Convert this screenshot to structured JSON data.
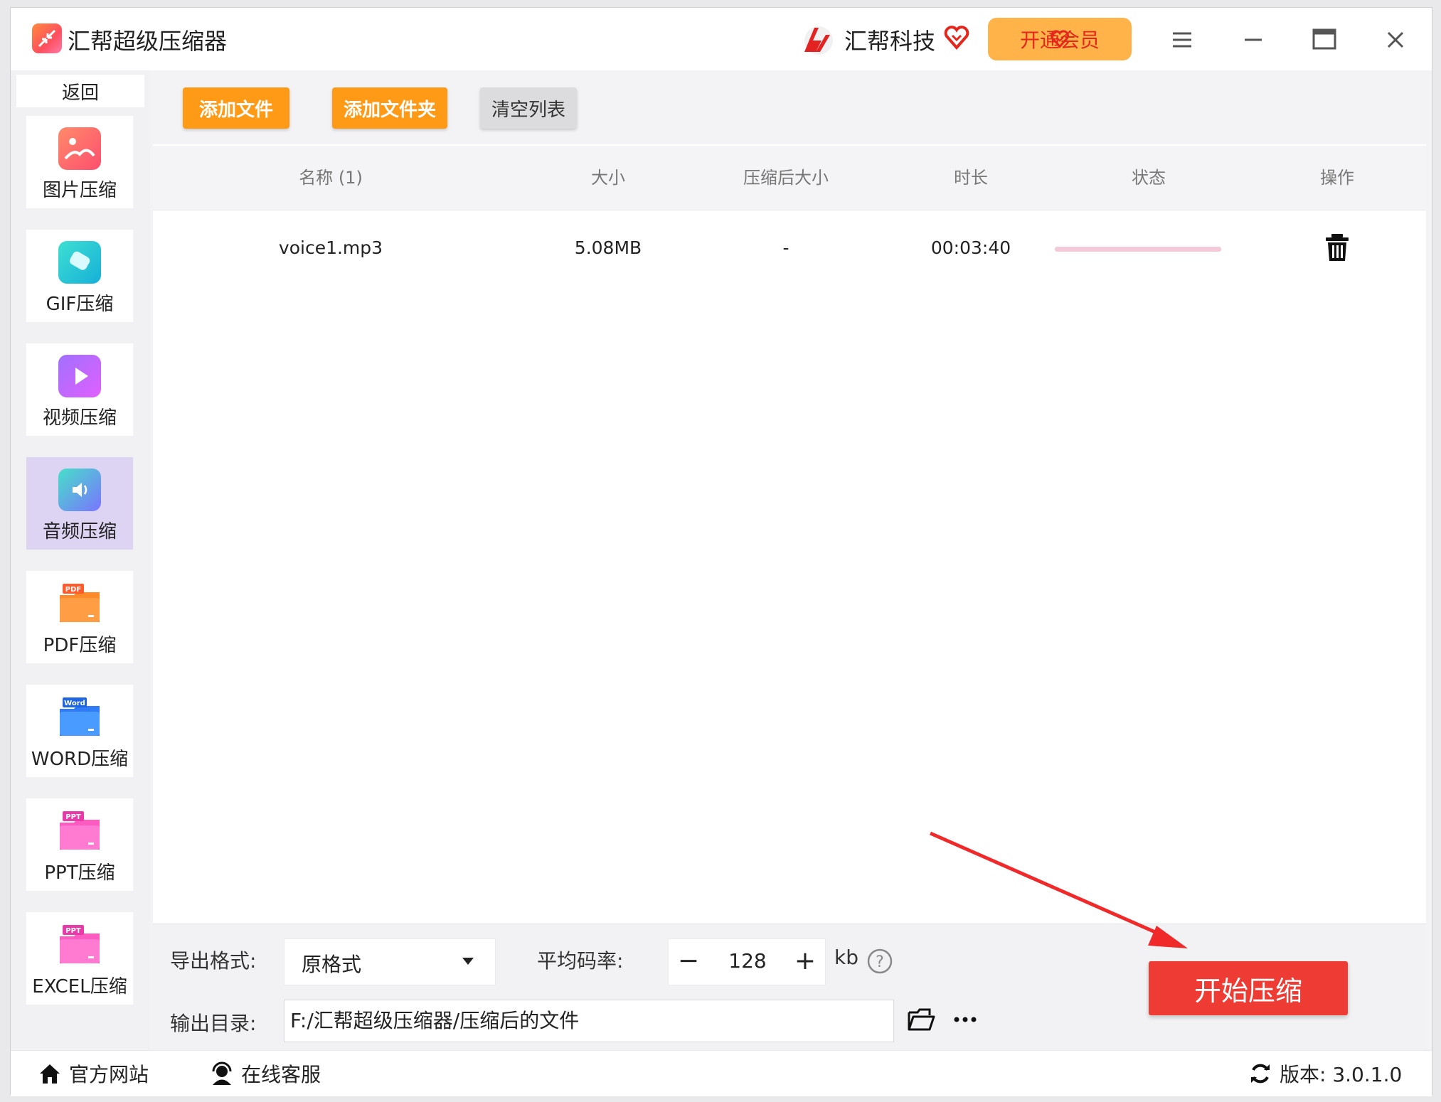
{
  "app": {
    "title": "汇帮超级压缩器"
  },
  "header": {
    "brand": "汇帮科技",
    "vip_label": "开通会员"
  },
  "sidebar": {
    "back_label": "返回",
    "items": [
      {
        "label": "图片压缩",
        "icon": "image-icon"
      },
      {
        "label": "GIF压缩",
        "icon": "gif-icon"
      },
      {
        "label": "视频压缩",
        "icon": "video-play-icon"
      },
      {
        "label": "音频压缩",
        "icon": "audio-icon",
        "active": true
      },
      {
        "label": "PDF压缩",
        "icon": "pdf-folder-icon",
        "badge": "PDF"
      },
      {
        "label": "WORD压缩",
        "icon": "word-folder-icon",
        "badge": "Word"
      },
      {
        "label": "PPT压缩",
        "icon": "ppt-folder-icon",
        "badge": "PPT"
      },
      {
        "label": "EXCEL压缩",
        "icon": "excel-folder-icon",
        "badge": "PPT"
      }
    ]
  },
  "toolbar": {
    "add_file": "添加文件",
    "add_folder": "添加文件夹",
    "clear_list": "清空列表"
  },
  "table": {
    "headers": [
      "名称 (1)",
      "大小",
      "压缩后大小",
      "时长",
      "状态",
      "操作"
    ],
    "rows": [
      {
        "name": "voice1.mp3",
        "size": "5.08MB",
        "compressed_size": "-",
        "duration": "00:03:40"
      }
    ]
  },
  "settings": {
    "format_label": "导出格式:",
    "format_value": "原格式",
    "bitrate_label": "平均码率:",
    "bitrate_value": "128",
    "bitrate_unit": "kb",
    "output_label": "输出目录:",
    "output_path": "F:/汇帮超级压缩器/压缩后的文件",
    "start_label": "开始压缩"
  },
  "footer": {
    "website": "官方网站",
    "support": "在线客服",
    "version": "版本: 3.0.1.0"
  },
  "colors": {
    "accent_orange": "#ff9a16",
    "start_red": "#ee3b33",
    "vip_bg": "#ffb349",
    "active_item": "#ddd3f3"
  }
}
